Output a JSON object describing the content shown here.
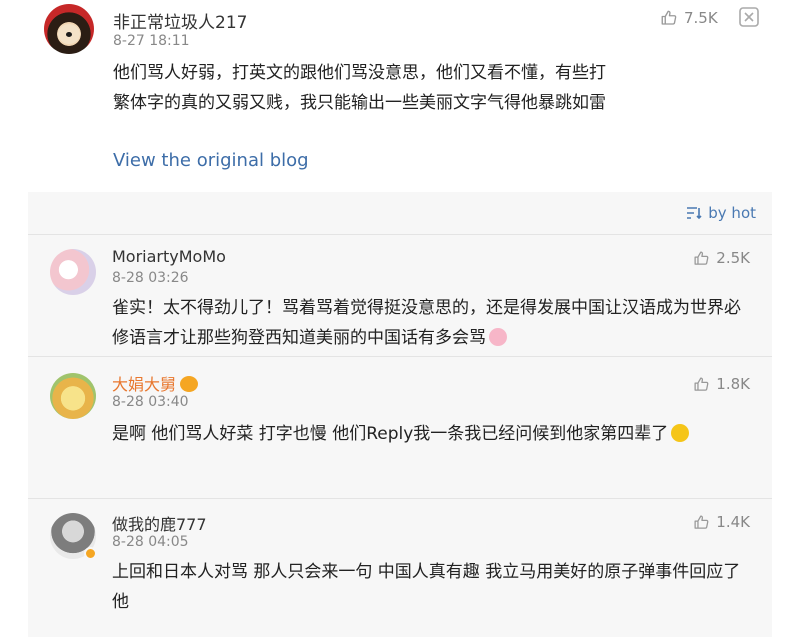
{
  "post": {
    "username": "非正常垃圾人217",
    "time": "8-27 18:11",
    "likes": "7.5K",
    "body": "他们骂人好弱，打英文的跟他们骂没意思，他们又看不懂，有些打繁体字的真的又弱又贱，我只能输出一些美丽文字气得他暴跳如雷",
    "view_original": "View the original blog"
  },
  "sort_label": "by hot",
  "comments": [
    {
      "username": "MoriartyMoMo",
      "time": "8-28 03:26",
      "likes": "2.5K",
      "text": "雀实！太不得劲儿了！骂着骂着觉得挺没意思的，还是得发展中国让汉语成为世界必修语言才让那些狗登西知道美丽的中国话有多会骂"
    },
    {
      "username": "大娟大舅",
      "time": "8-28 03:40",
      "likes": "1.8K",
      "text": "是啊 他们骂人好菜 打字也慢 他们Reply我一条我已经问候到他家第四辈了"
    },
    {
      "username": "做我的鹿777",
      "time": "8-28 04:05",
      "likes": "1.4K",
      "text": "上回和日本人对骂 那人只会来一句 中国人真有趣 我立马用美好的原子弹事件回应了他"
    }
  ],
  "colors": {
    "link": "#3d6da8",
    "sort": "#4a79b2",
    "vip_name": "#e8772e",
    "panel_bg": "#f7f7f7"
  },
  "icons": {
    "like": "thumbs-up-icon",
    "dismiss": "dismiss-icon",
    "sort": "sort-icon"
  }
}
